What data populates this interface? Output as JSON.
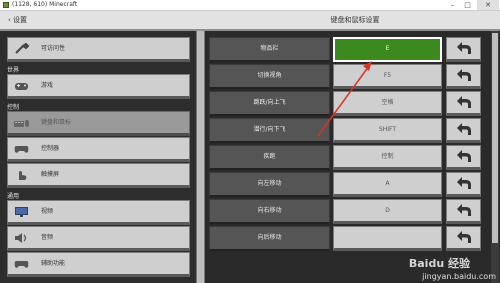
{
  "window": {
    "title": "(1128, 610) Minecraft",
    "min": "–",
    "max": "□",
    "close": "✕"
  },
  "header": {
    "back_label": "设置",
    "title": "键盘和鼠标设置"
  },
  "sidebar": {
    "sections": {
      "world": "世界",
      "controls": "控制",
      "general": "通用"
    },
    "items": [
      {
        "label": "可访问性",
        "icon": "wrench-icon"
      },
      {
        "label": "游戏",
        "icon": "gamepad-icon"
      },
      {
        "label": "键盘和鼠标",
        "icon": "keyboard-mouse-icon",
        "selected": true
      },
      {
        "label": "控制器",
        "icon": "controller-icon"
      },
      {
        "label": "触摸屏",
        "icon": "touch-hand-icon"
      },
      {
        "label": "视频",
        "icon": "monitor-icon"
      },
      {
        "label": "音频",
        "icon": "speaker-icon"
      },
      {
        "label": "辅助功能",
        "icon": "controller-icon"
      }
    ]
  },
  "bindings": [
    {
      "action": "物品栏",
      "key": "E",
      "active": true
    },
    {
      "action": "切换视角",
      "key": "F5"
    },
    {
      "action": "跳跃/向上飞",
      "key": "空格"
    },
    {
      "action": "潜行/向下飞",
      "key": "SHIFT"
    },
    {
      "action": "疾跑",
      "key": "控制"
    },
    {
      "action": "向左移动",
      "key": "A"
    },
    {
      "action": "向右移动",
      "key": "D"
    },
    {
      "action": "向后移动",
      "key": ""
    }
  ],
  "colors": {
    "accent_green": "#3c8a1f",
    "annotation_red": "#d9342b"
  },
  "watermark": {
    "logo": "Baidu 经验",
    "url": "jingyan.baidu.com"
  }
}
